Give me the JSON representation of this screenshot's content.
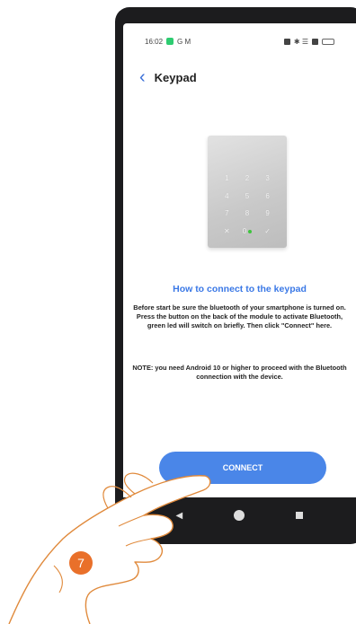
{
  "status_bar": {
    "time": "16:02",
    "left_icons": "G M",
    "right_icons": "✱ ☰"
  },
  "header": {
    "title": "Keypad"
  },
  "keypad": {
    "keys": [
      "1",
      "2",
      "3",
      "4",
      "5",
      "6",
      "7",
      "8",
      "9",
      "✕",
      "0",
      "✓"
    ]
  },
  "content": {
    "how_title": "How to connect to the keypad",
    "instruction_1": "Before start be sure the bluetooth of your smartphone is turned on.",
    "instruction_2": "Press the button on the back of the module to activate Bluetooth, green led will switch on briefly. Then click \"Connect\" here.",
    "note": "NOTE: you need Android 10 or higher to proceed with the Bluetooth connection with the device."
  },
  "actions": {
    "connect_label": "CONNECT"
  },
  "nav": {
    "back": "◀"
  },
  "step": {
    "number": "7"
  }
}
